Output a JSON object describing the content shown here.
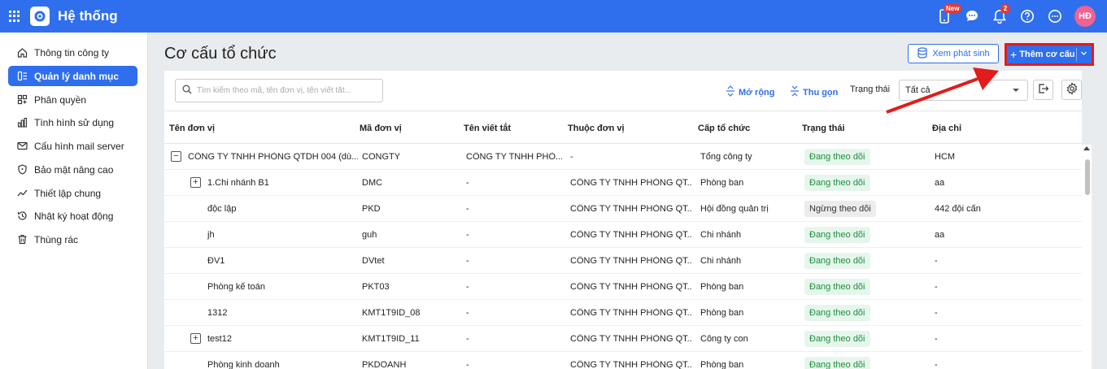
{
  "app": {
    "title": "Hệ thống",
    "user_initials": "HĐ",
    "badge_new": "New",
    "notif_count": "2"
  },
  "sidebar": {
    "items": [
      {
        "label": "Thông tin công ty",
        "icon": "home-icon"
      },
      {
        "label": "Quản lý danh mục",
        "icon": "list-icon",
        "active": true
      },
      {
        "label": "Phân quyền",
        "icon": "permission-icon"
      },
      {
        "label": "Tình hình sử dụng",
        "icon": "bar-chart-icon"
      },
      {
        "label": "Cấu hình mail server",
        "icon": "mail-icon"
      },
      {
        "label": "Bảo mật nâng cao",
        "icon": "shield-icon"
      },
      {
        "label": "Thiết lập chung",
        "icon": "trend-icon"
      },
      {
        "label": "Nhật ký hoạt động",
        "icon": "history-icon"
      },
      {
        "label": "Thùng rác",
        "icon": "trash-icon"
      }
    ]
  },
  "main": {
    "title": "Cơ cấu tổ chức",
    "view_changes_label": "Xem phát sinh",
    "add_label": "Thêm cơ cấu",
    "search_placeholder": "Tìm kiếm theo mã, tên đơn vị, tên viết tắt...",
    "expand_label": "Mở rộng",
    "collapse_label": "Thu gọn",
    "status_label": "Trạng thái",
    "status_value": "Tất cả"
  },
  "table": {
    "columns": [
      "Tên đơn vị",
      "Mã đơn vị",
      "Tên viết tắt",
      "Thuộc đơn vị",
      "Cấp tổ chức",
      "Trạng thái",
      "Địa chỉ"
    ],
    "rows": [
      {
        "toggle": "−",
        "name": "CÔNG TY TNHH PHÒNG QTDH 004 (dù...",
        "code": "CONGTY",
        "short": "CÔNG TY TNHH PHÒ...",
        "parent": "-",
        "level": "Tổng công ty",
        "status": "Đang theo dõi",
        "active": true,
        "address": "HCM"
      },
      {
        "toggle": "+",
        "name": "1.Chi nhánh B1",
        "code": "DMC",
        "short": "-",
        "parent": "CÔNG TY TNHH PHÒNG QT...",
        "level": "Phòng ban",
        "status": "Đang theo dõi",
        "active": true,
        "address": "aa"
      },
      {
        "toggle": "",
        "name": "độc lập",
        "code": "PKD",
        "short": "-",
        "parent": "CÔNG TY TNHH PHÒNG QT...",
        "level": "Hội đồng quản trị",
        "status": "Ngừng theo dõi",
        "active": false,
        "address": "442 đội cấn"
      },
      {
        "toggle": "",
        "name": "jh",
        "code": "guh",
        "short": "-",
        "parent": "CÔNG TY TNHH PHÒNG QT...",
        "level": "Chi nhánh",
        "status": "Đang theo dõi",
        "active": true,
        "address": "aa"
      },
      {
        "toggle": "",
        "name": "ĐV1",
        "code": "DVtet",
        "short": "-",
        "parent": "CÔNG TY TNHH PHÒNG QT...",
        "level": "Chi nhánh",
        "status": "Đang theo dõi",
        "active": true,
        "address": "-"
      },
      {
        "toggle": "",
        "name": "Phòng kế toán",
        "code": "PKT03",
        "short": "-",
        "parent": "CÔNG TY TNHH PHÒNG QT...",
        "level": "Phòng ban",
        "status": "Đang theo dõi",
        "active": true,
        "address": "-"
      },
      {
        "toggle": "",
        "name": "1312",
        "code": "KMT1T9ID_08",
        "short": "-",
        "parent": "CÔNG TY TNHH PHÒNG QT...",
        "level": "Phòng ban",
        "status": "Đang theo dõi",
        "active": true,
        "address": "-"
      },
      {
        "toggle": "+",
        "name": "test12",
        "code": "KMT1T9ID_11",
        "short": "-",
        "parent": "CÔNG TY TNHH PHÒNG QT...",
        "level": "Công ty con",
        "status": "Đang theo dõi",
        "active": true,
        "address": "-"
      },
      {
        "toggle": "",
        "name": "Phòng kinh doanh",
        "code": "PKDOANH",
        "short": "-",
        "parent": "CÔNG TY TNHH PHÒNG QT...",
        "level": "Phòng ban",
        "status": "Đang theo dõi",
        "active": true,
        "address": "-"
      }
    ]
  },
  "colors": {
    "primary": "#2f6fed",
    "highlight": "#e31b1b",
    "active_status": "#1e8e3e"
  }
}
